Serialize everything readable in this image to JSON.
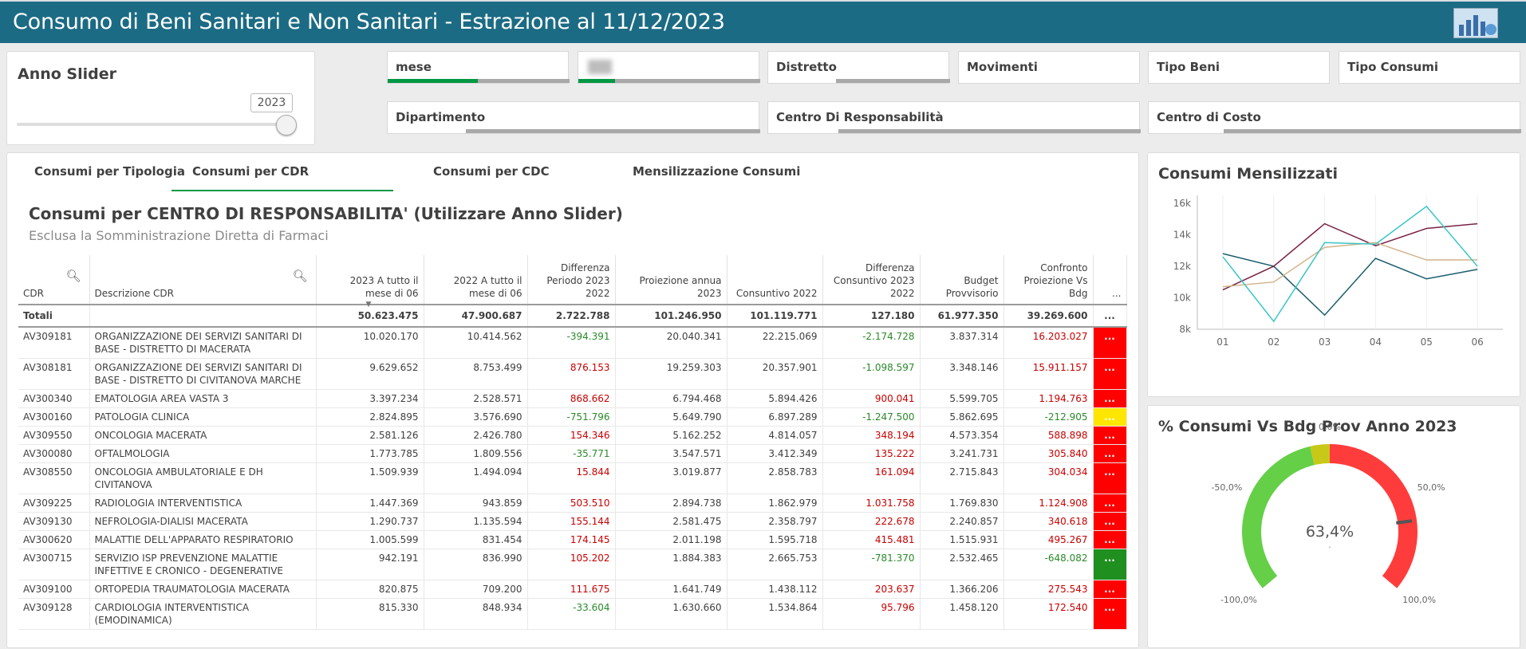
{
  "header": {
    "title": "Consumo di Beni Sanitari e Non Sanitari - Estrazione al 11/12/2023",
    "logo": "chart-logo-icon"
  },
  "slider": {
    "title": "Anno Slider",
    "value": "2023",
    "position": 1.0
  },
  "filters": [
    {
      "label": "mese"
    },
    {
      "label": ""
    },
    {
      "label": "Distretto"
    },
    {
      "label": "Movimenti"
    },
    {
      "label": "Tipo Beni"
    },
    {
      "label": "Tipo Consumi"
    },
    {
      "label": "Dipartimento"
    },
    {
      "label": "Centro Di Responsabilità"
    },
    {
      "label": "Centro di Costo"
    }
  ],
  "tabs": [
    "Consumi per Tipologia",
    "Consumi per CDR",
    "Consumi per CDC",
    "Mensilizzazione Consumi"
  ],
  "active_tab": 1,
  "table": {
    "title": "Consumi per CENTRO DI RESPONSABILITA' (Utilizzare Anno Slider)",
    "subtitle": "Esclusa la Somministrazione Diretta di Farmaci",
    "columns": [
      "CDR",
      "Descrizione CDR",
      "2023 A tutto il mese di 06",
      "2022 A tutto il mese di 06",
      "Differenza Periodo 2023 2022",
      "Proiezione annua 2023",
      "Consuntivo 2022",
      "Differenza Consuntivo 2023 2022",
      "Budget Provvisorio",
      "Confronto Proiezione Vs Bdg",
      "..."
    ],
    "totals": [
      "Totali",
      "",
      "50.623.475",
      "47.900.687",
      "2.722.788",
      "101.246.950",
      "101.119.771",
      "127.180",
      "61.977.350",
      "39.269.600",
      "..."
    ],
    "rows": [
      {
        "cells": [
          "AV309181",
          "ORGANIZZAZIONE DEI SERVIZI SANITARI DI BASE - DISTRETTO DI MACERATA",
          "10.020.170",
          "10.414.562",
          "-394.391",
          "20.040.341",
          "22.215.069",
          "-2.174.728",
          "3.837.314",
          "16.203.027",
          "..."
        ],
        "status": "red"
      },
      {
        "cells": [
          "AV308181",
          "ORGANIZZAZIONE DEI SERVIZI SANITARI DI BASE - DISTRETTO DI CIVITANOVA MARCHE",
          "9.629.652",
          "8.753.499",
          "876.153",
          "19.259.303",
          "20.357.901",
          "-1.098.597",
          "3.348.146",
          "15.911.157",
          "..."
        ],
        "status": "red"
      },
      {
        "cells": [
          "AV300340",
          "EMATOLOGIA AREA VASTA 3",
          "3.397.234",
          "2.528.571",
          "868.662",
          "6.794.468",
          "5.894.426",
          "900.041",
          "5.599.705",
          "1.194.763",
          "..."
        ],
        "status": "red"
      },
      {
        "cells": [
          "AV300160",
          "PATOLOGIA CLINICA",
          "2.824.895",
          "3.576.690",
          "-751.796",
          "5.649.790",
          "6.897.289",
          "-1.247.500",
          "5.862.695",
          "-212.905",
          "..."
        ],
        "status": "yellow"
      },
      {
        "cells": [
          "AV309550",
          "ONCOLOGIA MACERATA",
          "2.581.126",
          "2.426.780",
          "154.346",
          "5.162.252",
          "4.814.057",
          "348.194",
          "4.573.354",
          "588.898",
          "..."
        ],
        "status": "red"
      },
      {
        "cells": [
          "AV300080",
          "OFTALMOLOGIA",
          "1.773.785",
          "1.809.556",
          "-35.771",
          "3.547.571",
          "3.412.349",
          "135.222",
          "3.241.731",
          "305.840",
          "..."
        ],
        "status": "red"
      },
      {
        "cells": [
          "AV308550",
          "ONCOLOGIA AMBULATORIALE E DH CIVITANOVA",
          "1.509.939",
          "1.494.094",
          "15.844",
          "3.019.877",
          "2.858.783",
          "161.094",
          "2.715.843",
          "304.034",
          "..."
        ],
        "status": "red"
      },
      {
        "cells": [
          "AV309225",
          "RADIOLOGIA INTERVENTISTICA",
          "1.447.369",
          "943.859",
          "503.510",
          "2.894.738",
          "1.862.979",
          "1.031.758",
          "1.769.830",
          "1.124.908",
          "..."
        ],
        "status": "red"
      },
      {
        "cells": [
          "AV309130",
          "NEFROLOGIA-DIALISI MACERATA",
          "1.290.737",
          "1.135.594",
          "155.144",
          "2.581.475",
          "2.358.797",
          "222.678",
          "2.240.857",
          "340.618",
          "..."
        ],
        "status": "red"
      },
      {
        "cells": [
          "AV300620",
          "MALATTIE DELL'APPARATO RESPIRATORIO",
          "1.005.599",
          "831.454",
          "174.145",
          "2.011.198",
          "1.595.718",
          "415.481",
          "1.515.931",
          "495.267",
          "..."
        ],
        "status": "red"
      },
      {
        "cells": [
          "AV300715",
          "SERVIZIO ISP PREVENZIONE MALATTIE INFETTIVE E CRONICO - DEGENERATIVE",
          "942.191",
          "836.990",
          "105.202",
          "1.884.383",
          "2.665.753",
          "-781.370",
          "2.532.465",
          "-648.082",
          "..."
        ],
        "status": "green"
      },
      {
        "cells": [
          "AV309100",
          "ORTOPEDIA TRAUMATOLOGIA MACERATA",
          "820.875",
          "709.200",
          "111.675",
          "1.641.749",
          "1.438.112",
          "203.637",
          "1.366.206",
          "275.543",
          "..."
        ],
        "status": "red"
      },
      {
        "cells": [
          "AV309128",
          "CARDIOLOGIA INTERVENTISTICA (EMODINAMICA)",
          "815.330",
          "848.934",
          "-33.604",
          "1.630.660",
          "1.534.864",
          "95.796",
          "1.458.120",
          "172.540",
          "..."
        ],
        "status": "red"
      }
    ]
  },
  "chart_data": [
    {
      "type": "line",
      "title": "Consumi Mensilizzati",
      "categories": [
        "01",
        "02",
        "03",
        "04",
        "05",
        "06"
      ],
      "y_ticks": [
        "8k",
        "10k",
        "12k",
        "14k",
        "16k"
      ],
      "ylim": [
        8000,
        16500
      ],
      "grid": "vertical",
      "series": [
        {
          "values": [
            12800,
            12000,
            8900,
            12500,
            11200,
            11800
          ],
          "color": "#1a5e6e"
        },
        {
          "values": [
            10500,
            12000,
            14700,
            13300,
            14400,
            14700
          ],
          "color": "#7a2345"
        },
        {
          "values": [
            10700,
            11000,
            13200,
            13500,
            12400,
            12400
          ],
          "color": "#d2b48c"
        },
        {
          "values": [
            12600,
            8500,
            13500,
            13400,
            15800,
            12000
          ],
          "color": "#38c5c5"
        }
      ]
    },
    {
      "type": "gauge",
      "title": "% Consumi Vs Bdg Prov Anno 2023",
      "value_label": "63,4%",
      "value": 63.4,
      "range": [
        -100,
        100
      ],
      "tick_labels": [
        "-100,0%",
        "-50,0%",
        "0,0%",
        "50,0%",
        "100,0%"
      ],
      "segments": [
        {
          "from": -100,
          "to": -10,
          "color": "#65cf48"
        },
        {
          "from": -10,
          "to": 0,
          "color": "#c8c818"
        },
        {
          "from": 0,
          "to": 100,
          "color": "#ff3c3c"
        }
      ]
    }
  ]
}
